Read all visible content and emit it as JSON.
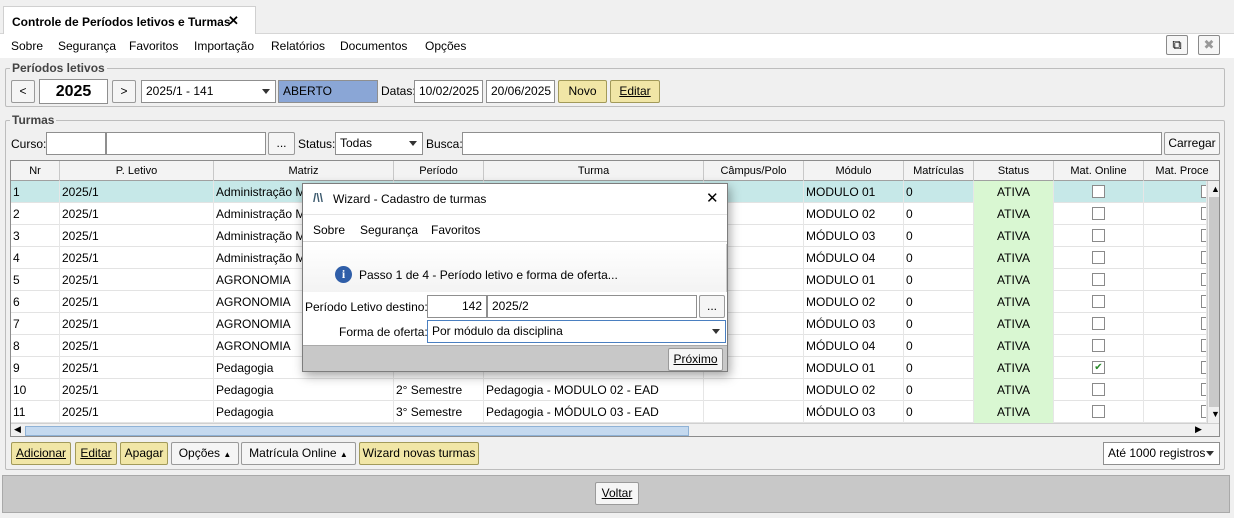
{
  "window": {
    "tab_title": "Controle de Períodos letivos e Turmas",
    "close_glyph": "✕",
    "popout_glyph": "⧉",
    "close_window_glyph": "✖"
  },
  "menu": [
    "Sobre",
    "Segurança",
    "Favoritos",
    "Importação",
    "Relatórios",
    "Documentos",
    "Opções"
  ],
  "periodos": {
    "legend": "Períodos letivos",
    "prev": "<",
    "next": ">",
    "year": "2025",
    "period_select": "2025/1 - 141",
    "state": "ABERTO",
    "dates_label": "Datas:",
    "date_start": "10/02/2025",
    "date_end": "20/06/2025",
    "novo": "Novo",
    "editar": "Editar"
  },
  "turmas": {
    "legend": "Turmas",
    "curso_label": "Curso:",
    "browse": "...",
    "status_label": "Status:",
    "status_value": "Todas",
    "busca_label": "Busca:",
    "carregar": "Carregar"
  },
  "table": {
    "columns": [
      "Nr",
      "P. Letivo",
      "Matriz",
      "Período",
      "Turma",
      "Câmpus/Polo",
      "Módulo",
      "Matrículas",
      "Status",
      "Mat. Online",
      "Mat. Proce"
    ],
    "rows": [
      {
        "nr": "1",
        "pl": "2025/1",
        "matriz": "Administração M",
        "periodo": "",
        "turma": "",
        "campus": "",
        "modulo": "MODULO 01",
        "matriculas": "0",
        "status": "ATIVA",
        "online": false
      },
      {
        "nr": "2",
        "pl": "2025/1",
        "matriz": "Administração M",
        "periodo": "",
        "turma": "",
        "campus": "",
        "modulo": "MODULO 02",
        "matriculas": "0",
        "status": "ATIVA",
        "online": false
      },
      {
        "nr": "3",
        "pl": "2025/1",
        "matriz": "Administração M",
        "periodo": "",
        "turma": "",
        "campus": "",
        "modulo": "MÓDULO 03",
        "matriculas": "0",
        "status": "ATIVA",
        "online": false
      },
      {
        "nr": "4",
        "pl": "2025/1",
        "matriz": "Administração M",
        "periodo": "",
        "turma": "",
        "campus": "",
        "modulo": "MÓDULO 04",
        "matriculas": "0",
        "status": "ATIVA",
        "online": false
      },
      {
        "nr": "5",
        "pl": "2025/1",
        "matriz": "AGRONOMIA",
        "periodo": "",
        "turma": "",
        "campus": "",
        "modulo": "MODULO 01",
        "matriculas": "0",
        "status": "ATIVA",
        "online": false
      },
      {
        "nr": "6",
        "pl": "2025/1",
        "matriz": "AGRONOMIA",
        "periodo": "",
        "turma": "",
        "campus": "",
        "modulo": "MODULO 02",
        "matriculas": "0",
        "status": "ATIVA",
        "online": false
      },
      {
        "nr": "7",
        "pl": "2025/1",
        "matriz": "AGRONOMIA",
        "periodo": "",
        "turma": "",
        "campus": "",
        "modulo": "MÓDULO 03",
        "matriculas": "0",
        "status": "ATIVA",
        "online": false
      },
      {
        "nr": "8",
        "pl": "2025/1",
        "matriz": "AGRONOMIA",
        "periodo": "",
        "turma": "",
        "campus": "",
        "modulo": "MÓDULO 04",
        "matriculas": "0",
        "status": "ATIVA",
        "online": false
      },
      {
        "nr": "9",
        "pl": "2025/1",
        "matriz": "Pedagogia",
        "periodo": "",
        "turma": "",
        "campus": "",
        "modulo": "MODULO 01",
        "matriculas": "0",
        "status": "ATIVA",
        "online": true
      },
      {
        "nr": "10",
        "pl": "2025/1",
        "matriz": "Pedagogia",
        "periodo": "2° Semestre",
        "turma": "Pedagogia - MODULO 02 - EAD",
        "campus": "",
        "modulo": "MODULO 02",
        "matriculas": "0",
        "status": "ATIVA",
        "online": false
      },
      {
        "nr": "11",
        "pl": "2025/1",
        "matriz": "Pedagogia",
        "periodo": "3° Semestre",
        "turma": "Pedagogia - MÓDULO 03 - EAD",
        "campus": "",
        "modulo": "MÓDULO 03",
        "matriculas": "0",
        "status": "ATIVA",
        "online": false
      }
    ]
  },
  "bottom": {
    "adicionar": "Adicionar",
    "editar": "Editar",
    "apagar": "Apagar",
    "opcoes": "Opções",
    "matricula_online": "Matrícula Online",
    "wizard": "Wizard novas turmas",
    "limit": "Até 1000 registros"
  },
  "footer": {
    "voltar": "Voltar"
  },
  "wizard": {
    "title": "Wizard - Cadastro de turmas",
    "menu": [
      "Sobre",
      "Segurança",
      "Favoritos"
    ],
    "step": "Passo 1 de 4 -  Período letivo e forma de oferta...",
    "dest_label": "Período Letivo destino:",
    "dest_code": "142",
    "dest_value": "2025/2",
    "browse": "...",
    "forma_label": "Forma de oferta:",
    "forma_value": "Por módulo da disciplina",
    "proximo": "Próximo"
  },
  "colors": {
    "status_green": "#d9f7d2",
    "selected_row": "#c6e8e8",
    "aberto_blue": "#8aa6d6",
    "button_yellow": "#f1e6a6"
  }
}
